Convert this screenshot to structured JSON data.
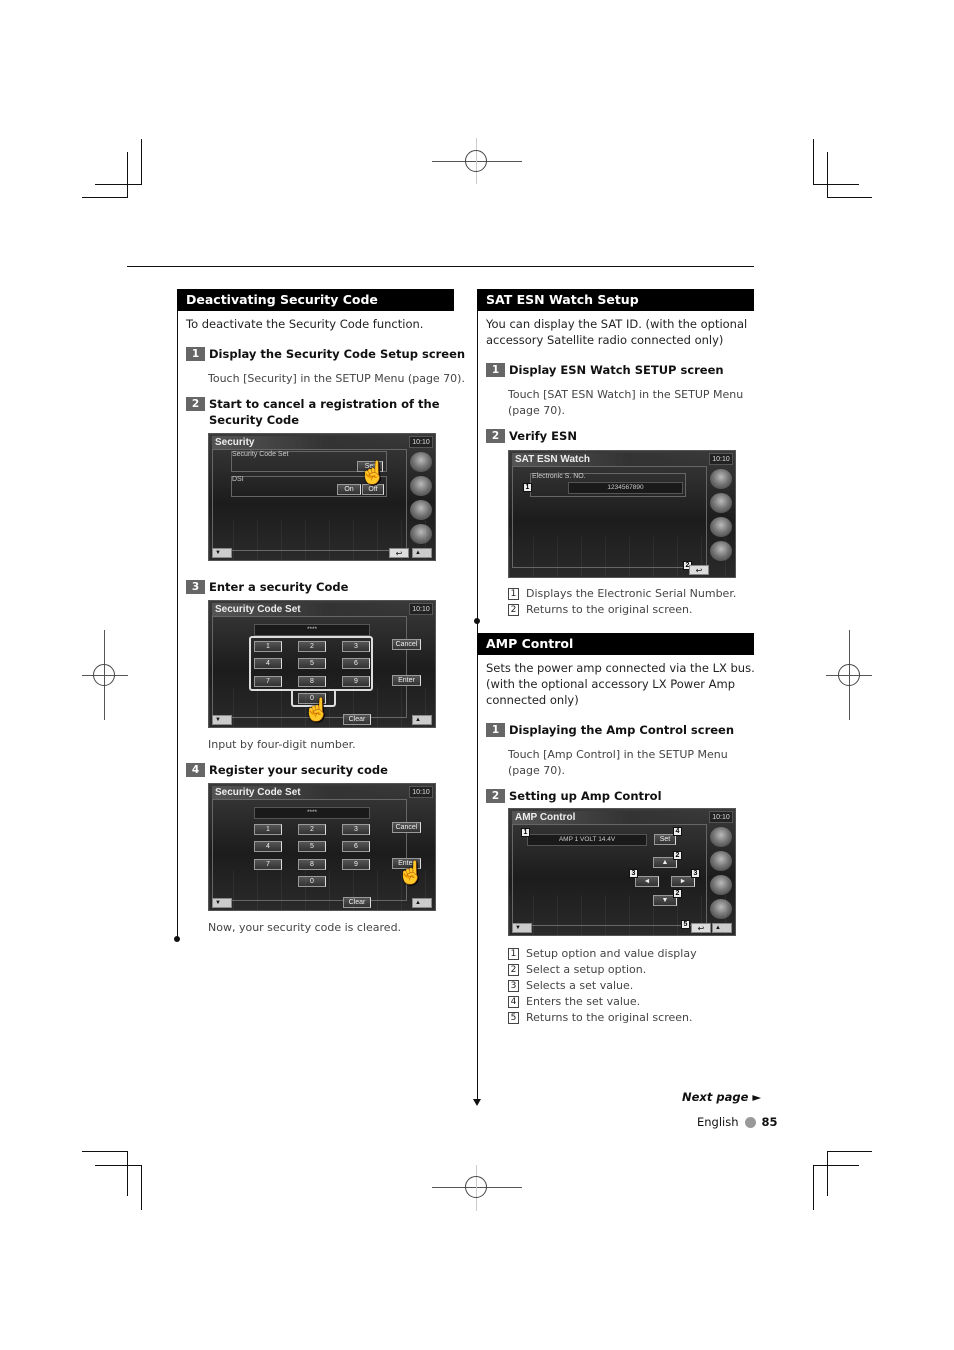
{
  "left_section": {
    "header": "Deactivating Security Code",
    "intro": "To deactivate the Security Code function.",
    "steps": [
      {
        "num": "1",
        "title": "Display the Security Code Setup screen",
        "desc": "Touch [Security] in the SETUP Menu (page 70)."
      },
      {
        "num": "2",
        "title_line1": "Start to cancel a registration of the",
        "title_line2": "Security Code"
      },
      {
        "num": "3",
        "title": "Enter a security Code",
        "desc": "Input by four-digit number."
      },
      {
        "num": "4",
        "title": "Register your security code",
        "desc": "Now, your security code is cleared."
      }
    ],
    "screen_security": {
      "title": "Security",
      "clock": "10:10",
      "row1_label": "Security Code Set",
      "row1_button": "Set",
      "row2_label": "DSI",
      "row2_on": "On",
      "row2_off": "Off"
    },
    "screen_codeset": {
      "title": "Security Code Set",
      "clock": "10:10",
      "code_display": "****",
      "keys": [
        "1",
        "2",
        "3",
        "4",
        "5",
        "6",
        "7",
        "8",
        "9",
        "0"
      ],
      "cancel": "Cancel",
      "enter": "Enter",
      "clear": "Clear"
    }
  },
  "right_section_sat": {
    "header": "SAT ESN Watch Setup",
    "intro_line1": "You can display the SAT ID. (with the optional",
    "intro_line2": "accessory Satellite radio connected only)",
    "steps": [
      {
        "num": "1",
        "title": "Display ESN Watch SETUP screen",
        "desc_line1": "Touch [SAT ESN Watch] in the SETUP Menu",
        "desc_line2": "(page 70)."
      },
      {
        "num": "2",
        "title": "Verify ESN"
      }
    ],
    "screen": {
      "title": "SAT ESN Watch",
      "clock": "10:10",
      "field_label": "Electronic S. NO.",
      "field_value": "1234567890"
    },
    "legend": [
      {
        "num": "1",
        "text": "Displays the Electronic Serial Number."
      },
      {
        "num": "2",
        "text": "Returns to the original screen."
      }
    ]
  },
  "right_section_amp": {
    "header": "AMP Control",
    "intro_line1": "Sets the power amp connected via the LX bus.",
    "intro_line2": "(with the optional accessory LX Power Amp",
    "intro_line3": "connected only)",
    "steps": [
      {
        "num": "1",
        "title": "Displaying the Amp Control screen",
        "desc_line1": "Touch [Amp Control] in the SETUP Menu",
        "desc_line2": "(page 70)."
      },
      {
        "num": "2",
        "title": "Setting up Amp Control"
      }
    ],
    "screen": {
      "title": "AMP Control",
      "clock": "10:10",
      "value_display": "AMP 1 VOLT 14.4V",
      "set_button": "Set",
      "up_arrow": "▲",
      "down_arrow": "▼",
      "left_arrow": "◄",
      "right_arrow": "►"
    },
    "legend": [
      {
        "num": "1",
        "text": "Setup option and value display"
      },
      {
        "num": "2",
        "text": "Select a setup option."
      },
      {
        "num": "3",
        "text": "Selects a set value."
      },
      {
        "num": "4",
        "text": "Enters the set value."
      },
      {
        "num": "5",
        "text": "Returns to the original screen."
      }
    ]
  },
  "common": {
    "down_btn": "▼",
    "up_btn": "▲",
    "back_icon": "↩",
    "callouts": [
      "1",
      "2",
      "3",
      "4",
      "5"
    ]
  },
  "footer": {
    "next_page": "Next page ►",
    "language": "English",
    "page_number": "85"
  }
}
